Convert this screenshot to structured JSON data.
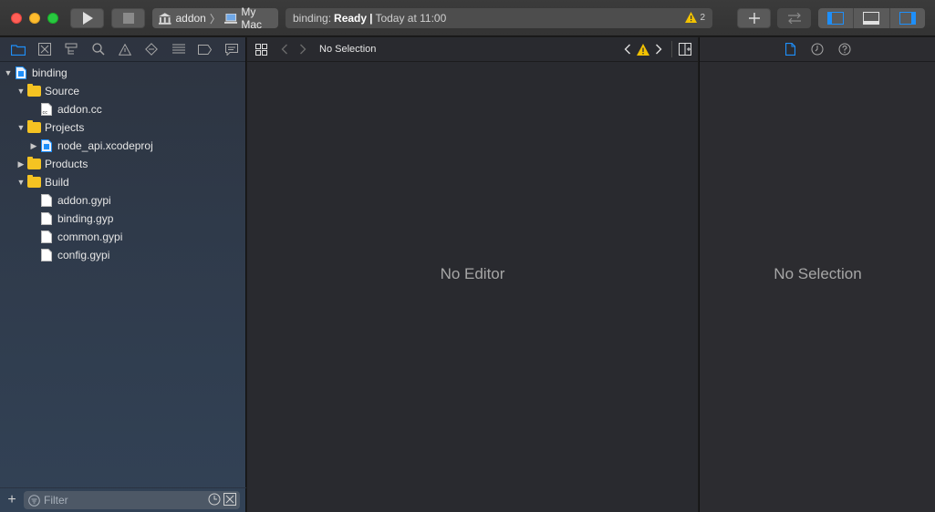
{
  "toolbar": {
    "scheme": {
      "target": "addon",
      "destination": "My Mac"
    },
    "activity": {
      "prefix": "binding:",
      "status": "Ready",
      "separator": "|",
      "time": "Today at 11:00",
      "warning_count": "2"
    },
    "colors": {
      "accent": "#1e8ffa",
      "warning": "#f2c200"
    }
  },
  "navigator": {
    "tabs": [
      "project-navigator-icon",
      "source-control-icon",
      "symbol-navigator-icon",
      "find-icon",
      "issue-icon",
      "test-icon",
      "debug-icon",
      "breakpoint-icon",
      "report-icon"
    ],
    "tree": [
      {
        "label": "binding",
        "level": 0,
        "type": "project",
        "expanded": true
      },
      {
        "label": "Source",
        "level": 1,
        "type": "folder",
        "expanded": true
      },
      {
        "label": "addon.cc",
        "level": 2,
        "type": "cc-file"
      },
      {
        "label": "Projects",
        "level": 1,
        "type": "folder",
        "expanded": true
      },
      {
        "label": "node_api.xcodeproj",
        "level": 2,
        "type": "project",
        "expanded": false
      },
      {
        "label": "Products",
        "level": 1,
        "type": "folder",
        "expanded": false
      },
      {
        "label": "Build",
        "level": 1,
        "type": "folder",
        "expanded": true
      },
      {
        "label": "addon.gypi",
        "level": 2,
        "type": "file"
      },
      {
        "label": "binding.gyp",
        "level": 2,
        "type": "file"
      },
      {
        "label": "common.gypi",
        "level": 2,
        "type": "file"
      },
      {
        "label": "config.gypi",
        "level": 2,
        "type": "file"
      }
    ],
    "filter": {
      "placeholder": "Filter"
    }
  },
  "editor": {
    "jump_bar": {
      "label": "No Selection"
    },
    "empty_text": "No Editor"
  },
  "inspector": {
    "empty_text": "No Selection"
  }
}
